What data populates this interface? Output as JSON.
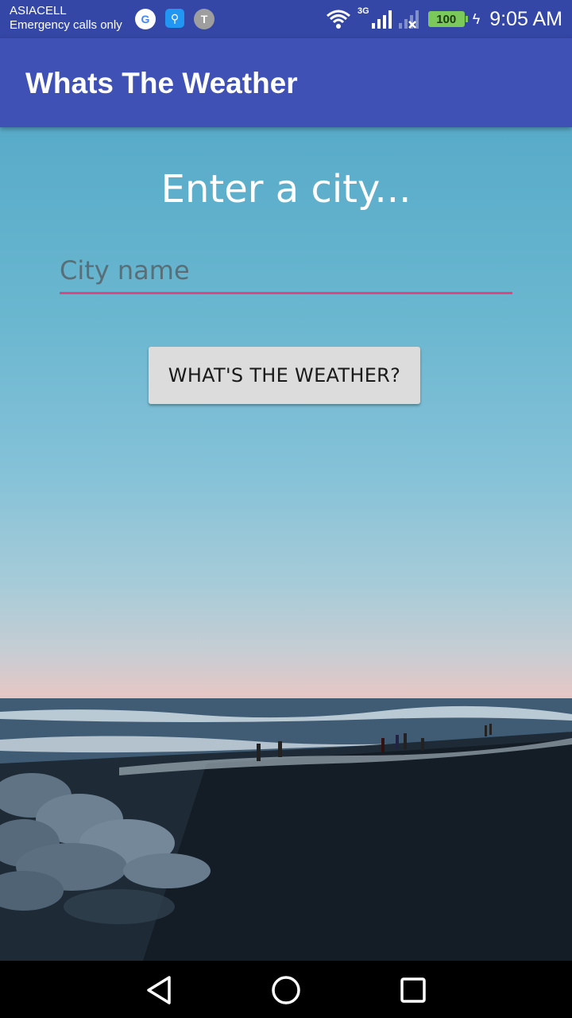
{
  "status_bar": {
    "carrier": "ASIACELL",
    "carrier_status": "Emergency calls only",
    "notification_icons": [
      "google-icon",
      "usb-icon",
      "t-icon"
    ],
    "t_icon_letter": "T",
    "network_type": "3G",
    "battery_level": "100",
    "time": "9:05 AM"
  },
  "app_bar": {
    "title": "Whats The Weather"
  },
  "main": {
    "prompt": "Enter a city...",
    "city_input": {
      "placeholder": "City name",
      "value": ""
    },
    "weather_button_label": "WHAT'S THE WEATHER?"
  },
  "colors": {
    "status_bar": "#3447a6",
    "app_bar": "#3f51b5",
    "input_underline": "#e0457f",
    "button": "#dcdcdc"
  },
  "nav_bar": {
    "buttons": [
      "back-icon",
      "home-icon",
      "recent-apps-icon"
    ]
  }
}
